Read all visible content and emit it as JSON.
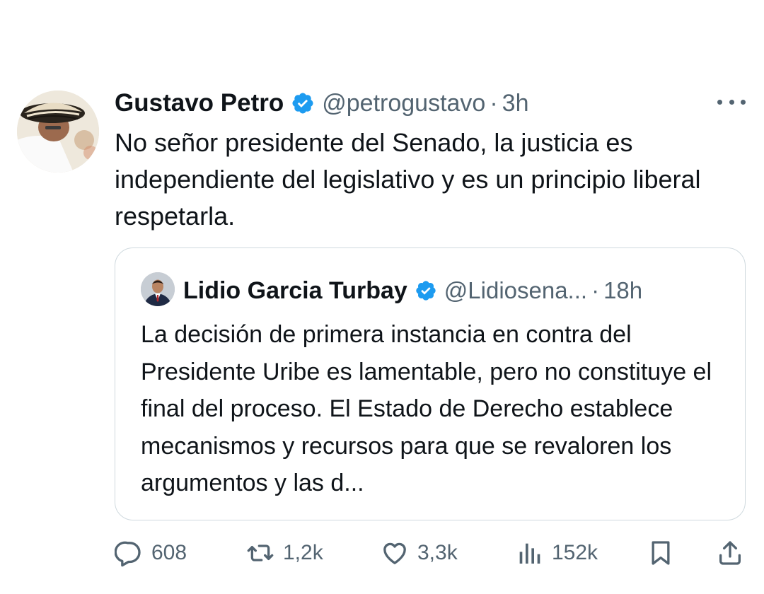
{
  "tweet": {
    "author_name": "Gustavo Petro",
    "author_handle": "@petrogustavo",
    "separator": "·",
    "time": "3h",
    "text": "No señor presidente del Senado, la justicia es independiente del legislativo y es un principio liberal respetarla.",
    "verified_color": "#1d9bf0"
  },
  "quote": {
    "author_name": "Lidio Garcia Turbay",
    "author_handle": "@Lidiosena...",
    "separator": "·",
    "time": "18h",
    "text": "La decisión de primera instancia en contra del Presidente Uribe es lamentable, pero no constituye el final del proceso. El Estado de Derecho establece mecanismos y recursos para que se revaloren los argumentos y las d..."
  },
  "actions": {
    "replies": "608",
    "reposts": "1,2k",
    "likes": "3,3k",
    "views": "152k"
  },
  "icons": {
    "verified": "verified-badge-icon",
    "more": "more-options-icon",
    "reply": "reply-bubble-icon",
    "repost": "repost-icon",
    "like": "heart-icon",
    "views": "views-chart-icon",
    "bookmark": "bookmark-icon",
    "share": "share-icon"
  }
}
